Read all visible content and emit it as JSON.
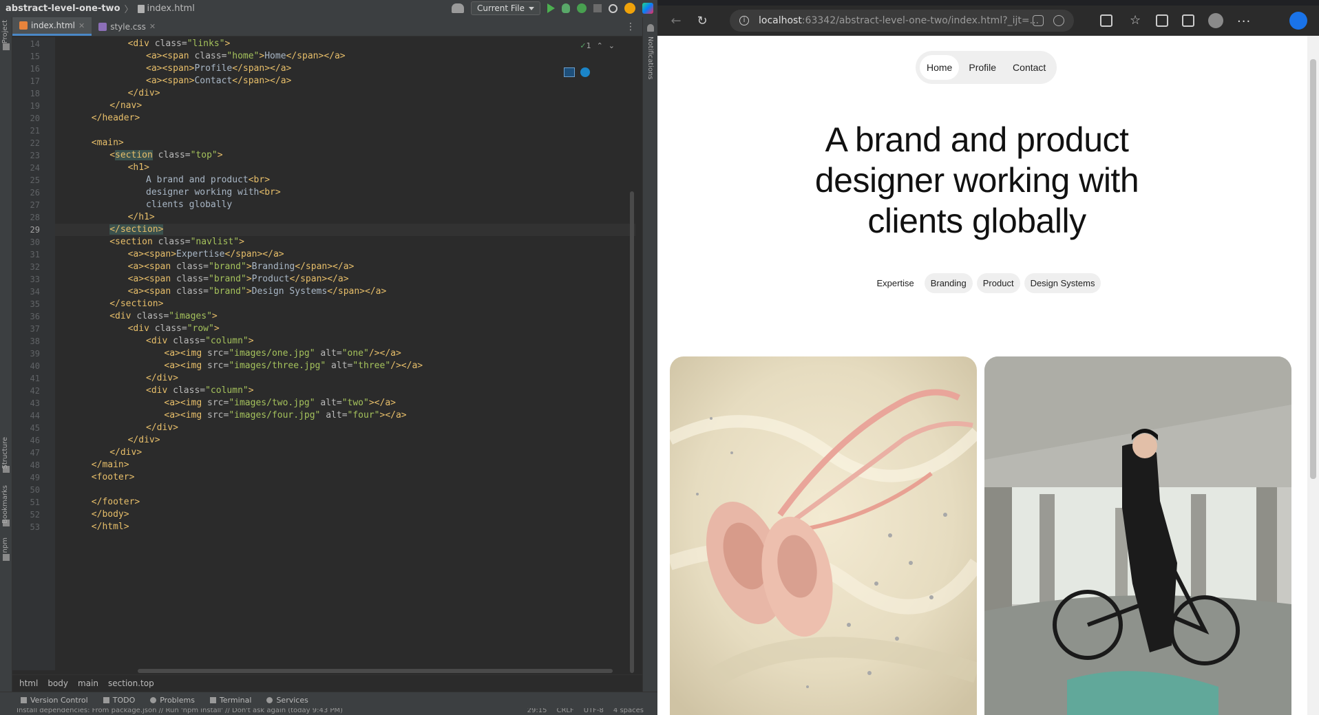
{
  "ide": {
    "project_name": "abstract-level-one-two",
    "title_file": "index.html",
    "run_config": "Current File",
    "tabs": [
      {
        "label": "index.html",
        "active": true
      },
      {
        "label": "style.css",
        "active": false
      }
    ],
    "left_strip": [
      "Project",
      "Structure",
      "Bookmarks",
      "npm"
    ],
    "right_strip": [
      "Notifications"
    ],
    "inspection_count": "1",
    "breadcrumb": [
      "html",
      "body",
      "main",
      "section.top"
    ],
    "tool_windows": [
      "Version Control",
      "TODO",
      "Problems",
      "Terminal",
      "Services"
    ],
    "status_message": "Install dependencies: From package.json // Run 'npm install' // Don't ask again (today 9:43 PM)",
    "status_right": [
      "29:15",
      "CRLF",
      "UTF-8",
      "4 spaces"
    ],
    "current_line": 29,
    "code_lines": [
      {
        "n": 14,
        "indent": 16,
        "html": "<span class='t'>&lt;div</span> <span class='a'>class=</span><span class='v'>\"links\"</span><span class='t'>&gt;</span>"
      },
      {
        "n": 15,
        "indent": 20,
        "html": "<span class='t'>&lt;a&gt;&lt;span</span> <span class='a'>class=</span><span class='v'>\"home\"</span><span class='t'>&gt;</span>Home<span class='t'>&lt;/span&gt;&lt;/a&gt;</span>"
      },
      {
        "n": 16,
        "indent": 20,
        "html": "<span class='t'>&lt;a&gt;&lt;span&gt;</span>Profile<span class='t'>&lt;/span&gt;&lt;/a&gt;</span>"
      },
      {
        "n": 17,
        "indent": 20,
        "html": "<span class='t'>&lt;a&gt;&lt;span&gt;</span>Contact<span class='t'>&lt;/span&gt;&lt;/a&gt;</span>"
      },
      {
        "n": 18,
        "indent": 16,
        "html": "<span class='t'>&lt;/div&gt;</span>"
      },
      {
        "n": 19,
        "indent": 12,
        "html": "<span class='t'>&lt;/nav&gt;</span>"
      },
      {
        "n": 20,
        "indent": 8,
        "html": "<span class='t'>&lt;/header&gt;</span>"
      },
      {
        "n": 21,
        "indent": 0,
        "html": ""
      },
      {
        "n": 22,
        "indent": 8,
        "html": "<span class='t'>&lt;main&gt;</span>"
      },
      {
        "n": 23,
        "indent": 12,
        "html": "<span class='t'>&lt;<span class='hl'>section</span></span> <span class='a'>class=</span><span class='v'>\"top\"</span><span class='t'>&gt;</span>"
      },
      {
        "n": 24,
        "indent": 16,
        "html": "<span class='t'>&lt;h1&gt;</span>"
      },
      {
        "n": 25,
        "indent": 20,
        "html": "A brand and product<span class='t'>&lt;br&gt;</span>"
      },
      {
        "n": 26,
        "indent": 20,
        "html": "designer working with<span class='t'>&lt;br&gt;</span>"
      },
      {
        "n": 27,
        "indent": 20,
        "html": "clients globally"
      },
      {
        "n": 28,
        "indent": 16,
        "html": "<span class='t'>&lt;/h1&gt;</span>"
      },
      {
        "n": 29,
        "indent": 12,
        "html": "<span class='t hl'>&lt;/section&gt;</span>"
      },
      {
        "n": 30,
        "indent": 12,
        "html": "<span class='t'>&lt;section</span> <span class='a'>class=</span><span class='v'>\"navlist\"</span><span class='t'>&gt;</span>"
      },
      {
        "n": 31,
        "indent": 16,
        "html": "<span class='t'>&lt;a&gt;&lt;span&gt;</span>Expertise<span class='t'>&lt;/span&gt;&lt;/a&gt;</span>"
      },
      {
        "n": 32,
        "indent": 16,
        "html": "<span class='t'>&lt;a&gt;&lt;span</span> <span class='a'>class=</span><span class='v'>\"brand\"</span><span class='t'>&gt;</span>Branding<span class='t'>&lt;/span&gt;&lt;/a&gt;</span>"
      },
      {
        "n": 33,
        "indent": 16,
        "html": "<span class='t'>&lt;a&gt;&lt;span</span> <span class='a'>class=</span><span class='v'>\"brand\"</span><span class='t'>&gt;</span>Product<span class='t'>&lt;/span&gt;&lt;/a&gt;</span>"
      },
      {
        "n": 34,
        "indent": 16,
        "html": "<span class='t'>&lt;a&gt;&lt;span</span> <span class='a'>class=</span><span class='v'>\"brand\"</span><span class='t'>&gt;</span>Design Systems<span class='t'>&lt;/span&gt;&lt;/a&gt;</span>"
      },
      {
        "n": 35,
        "indent": 12,
        "html": "<span class='t'>&lt;/section&gt;</span>"
      },
      {
        "n": 36,
        "indent": 12,
        "html": "<span class='t'>&lt;div</span> <span class='a'>class=</span><span class='v'>\"images\"</span><span class='t'>&gt;</span>"
      },
      {
        "n": 37,
        "indent": 16,
        "html": "<span class='t'>&lt;div</span> <span class='a'>class=</span><span class='v'>\"row\"</span><span class='t'>&gt;</span>"
      },
      {
        "n": 38,
        "indent": 20,
        "html": "<span class='t'>&lt;div</span> <span class='a'>class=</span><span class='v'>\"column\"</span><span class='t'>&gt;</span>"
      },
      {
        "n": 39,
        "indent": 24,
        "html": "<span class='t'>&lt;a&gt;&lt;img</span> <span class='a'>src=</span><span class='v'>\"images/one.jpg\"</span> <span class='a'>alt=</span><span class='v'>\"one\"</span><span class='t'>/&gt;&lt;/a&gt;</span>"
      },
      {
        "n": 40,
        "indent": 24,
        "html": "<span class='t'>&lt;a&gt;&lt;img</span> <span class='a'>src=</span><span class='v'>\"images/three.jpg\"</span> <span class='a'>alt=</span><span class='v'>\"three\"</span><span class='t'>/&gt;&lt;/a&gt;</span>"
      },
      {
        "n": 41,
        "indent": 20,
        "html": "<span class='t'>&lt;/div&gt;</span>"
      },
      {
        "n": 42,
        "indent": 20,
        "html": "<span class='t'>&lt;div</span> <span class='a'>class=</span><span class='v'>\"column\"</span><span class='t'>&gt;</span>"
      },
      {
        "n": 43,
        "indent": 24,
        "html": "<span class='t'>&lt;a&gt;&lt;img</span> <span class='a'>src=</span><span class='v'>\"images/two.jpg\"</span> <span class='a'>alt=</span><span class='v'>\"two\"</span><span class='t'>&gt;&lt;/a&gt;</span>"
      },
      {
        "n": 44,
        "indent": 24,
        "html": "<span class='t'>&lt;a&gt;&lt;img</span> <span class='a'>src=</span><span class='v'>\"images/four.jpg\"</span> <span class='a'>alt=</span><span class='v'>\"four\"</span><span class='t'>&gt;&lt;/a&gt;</span>"
      },
      {
        "n": 45,
        "indent": 20,
        "html": "<span class='t'>&lt;/div&gt;</span>"
      },
      {
        "n": 46,
        "indent": 16,
        "html": "<span class='t'>&lt;/div&gt;</span>"
      },
      {
        "n": 47,
        "indent": 12,
        "html": "<span class='t'>&lt;/div&gt;</span>"
      },
      {
        "n": 48,
        "indent": 8,
        "html": "<span class='t'>&lt;/main&gt;</span>"
      },
      {
        "n": 49,
        "indent": 8,
        "html": "<span class='t'>&lt;footer&gt;</span>"
      },
      {
        "n": 50,
        "indent": 0,
        "html": ""
      },
      {
        "n": 51,
        "indent": 8,
        "html": "<span class='t'>&lt;/footer&gt;</span>"
      },
      {
        "n": 52,
        "indent": 8,
        "html": "<span class='t'>&lt;/body&gt;</span>"
      },
      {
        "n": 53,
        "indent": 8,
        "html": "<span class='t'>&lt;/html&gt;</span>"
      }
    ]
  },
  "browser": {
    "url_host": "localhost",
    "url_path": ":63342/abstract-level-one-two/index.html?_ijt=...",
    "page": {
      "nav": [
        "Home",
        "Profile",
        "Contact"
      ],
      "title_lines": [
        "A brand and product",
        "designer working with",
        "clients globally"
      ],
      "navlist": [
        {
          "label": "Expertise",
          "brand": false
        },
        {
          "label": "Branding",
          "brand": true
        },
        {
          "label": "Product",
          "brand": true
        },
        {
          "label": "Design Systems",
          "brand": true
        }
      ],
      "images": [
        {
          "alt": "one",
          "subject": "pink ballet shoes on tulle dress"
        },
        {
          "alt": "two",
          "subject": "person standing with bmx bike"
        }
      ]
    }
  }
}
